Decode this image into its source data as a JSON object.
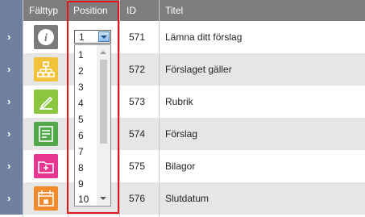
{
  "columns": {
    "fieldtype": "Fälttyp",
    "position": "Position",
    "id": "ID",
    "title": "Titel"
  },
  "rows": [
    {
      "id": "571",
      "title": "Lämna ditt förslag",
      "icon": "info-icon",
      "color": "#7a7a7a"
    },
    {
      "id": "572",
      "title": "Förslaget gäller",
      "icon": "hierarchy-icon",
      "color": "#f2c23a"
    },
    {
      "id": "573",
      "title": "Rubrik",
      "icon": "pencil-icon",
      "color": "#8cc63e"
    },
    {
      "id": "574",
      "title": "Förslag",
      "icon": "text-document-icon",
      "color": "#52a84a"
    },
    {
      "id": "575",
      "title": "Bilagor",
      "icon": "folder-plus-icon",
      "color": "#e7368f"
    },
    {
      "id": "576",
      "title": "Slutdatum",
      "icon": "calendar-icon",
      "color": "#f28a2e"
    }
  ],
  "position_select": {
    "selected": "1",
    "options": [
      "1",
      "2",
      "3",
      "4",
      "5",
      "6",
      "7",
      "8",
      "9",
      "10"
    ]
  },
  "expand_glyph": "›",
  "highlight_color": "#e0161c"
}
